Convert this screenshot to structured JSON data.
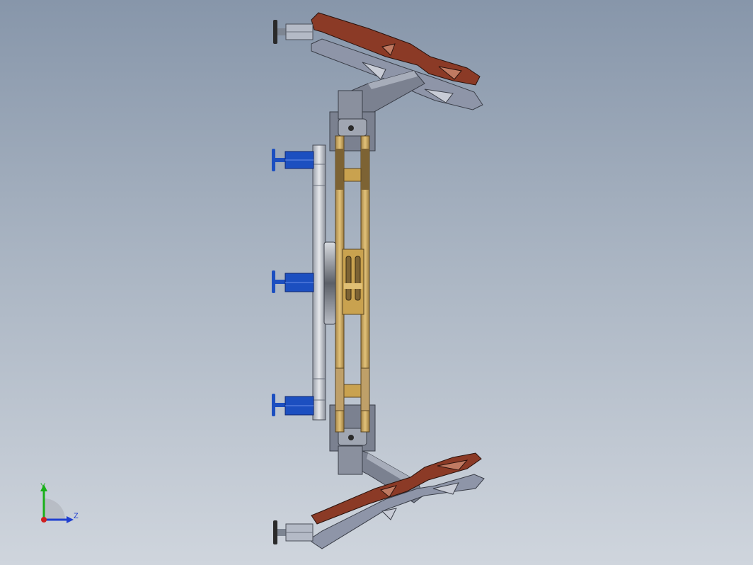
{
  "viewport": {
    "background_top": "#8796aa",
    "background_bottom": "#cfd5dd"
  },
  "model": {
    "colors": {
      "arm_upper": "#8b3a26",
      "arm_lower": "#8e95a8",
      "frame": "#c9a24f",
      "frame_dark": "#7d6334",
      "plate": "#c4c8d0",
      "bracket": "#7b8190",
      "actuator": "#1c4fc0",
      "stud": "#2a2a2a"
    }
  },
  "triad": {
    "y_label": "Y",
    "z_label": "Z",
    "y_color": "#19b019",
    "z_color": "#1f3fd0",
    "origin_color": "#d02020"
  }
}
